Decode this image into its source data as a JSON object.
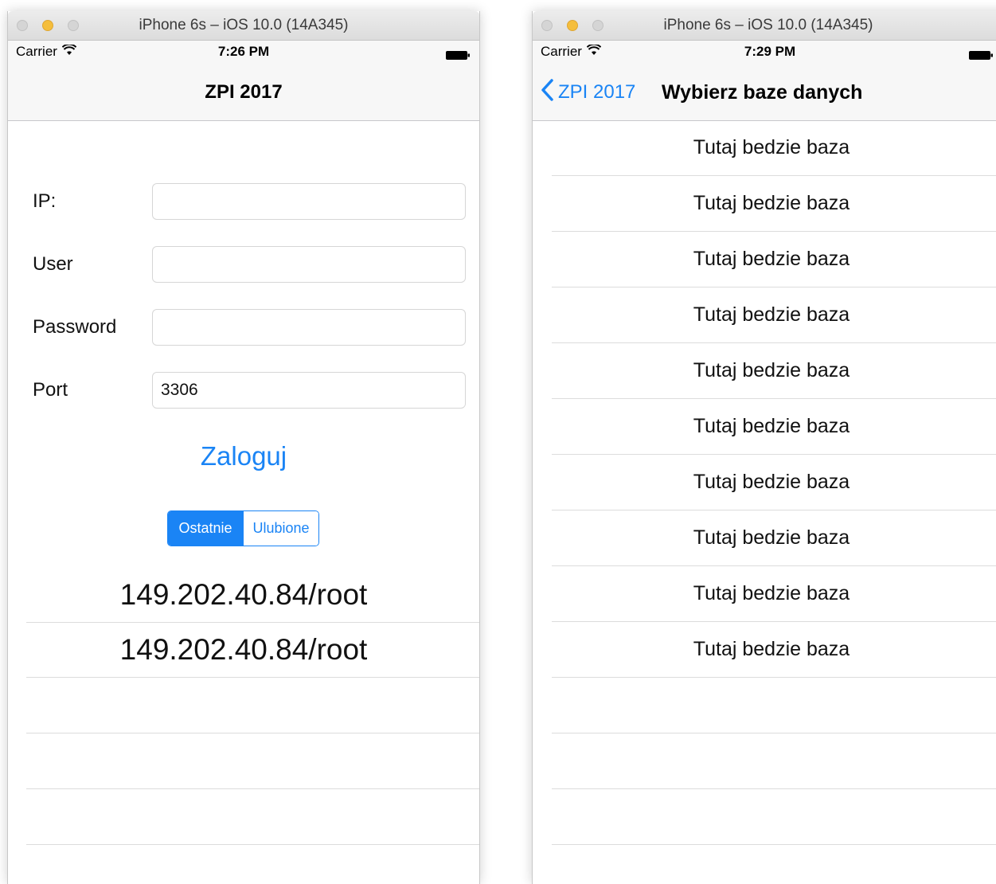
{
  "left_window": {
    "title": "iPhone 6s – iOS 10.0 (14A345)",
    "status": {
      "carrier": "Carrier",
      "time": "7:26 PM"
    },
    "nav_title": "ZPI 2017",
    "form": {
      "ip_label": "IP:",
      "ip_value": "",
      "user_label": "User",
      "user_value": "",
      "password_label": "Password",
      "password_value": "",
      "port_label": "Port",
      "port_value": "3306"
    },
    "login_label": "Zaloguj",
    "segments": {
      "recent": "Ostatnie",
      "favorites": "Ulubione",
      "selected": "recent"
    },
    "history": [
      "149.202.40.84/root",
      "149.202.40.84/root"
    ]
  },
  "right_window": {
    "title": "iPhone 6s – iOS 10.0 (14A345)",
    "status": {
      "carrier": "Carrier",
      "time": "7:29 PM"
    },
    "back_label": "ZPI 2017",
    "nav_title": "Wybierz baze danych",
    "databases": [
      "Tutaj bedzie baza",
      "Tutaj bedzie baza",
      "Tutaj bedzie baza",
      "Tutaj bedzie baza",
      "Tutaj bedzie baza",
      "Tutaj bedzie baza",
      "Tutaj bedzie baza",
      "Tutaj bedzie baza",
      "Tutaj bedzie baza",
      "Tutaj bedzie baza"
    ]
  },
  "colors": {
    "accent": "#1a84f5",
    "separator": "#dcdcdc",
    "bar": "#f7f7f7"
  }
}
